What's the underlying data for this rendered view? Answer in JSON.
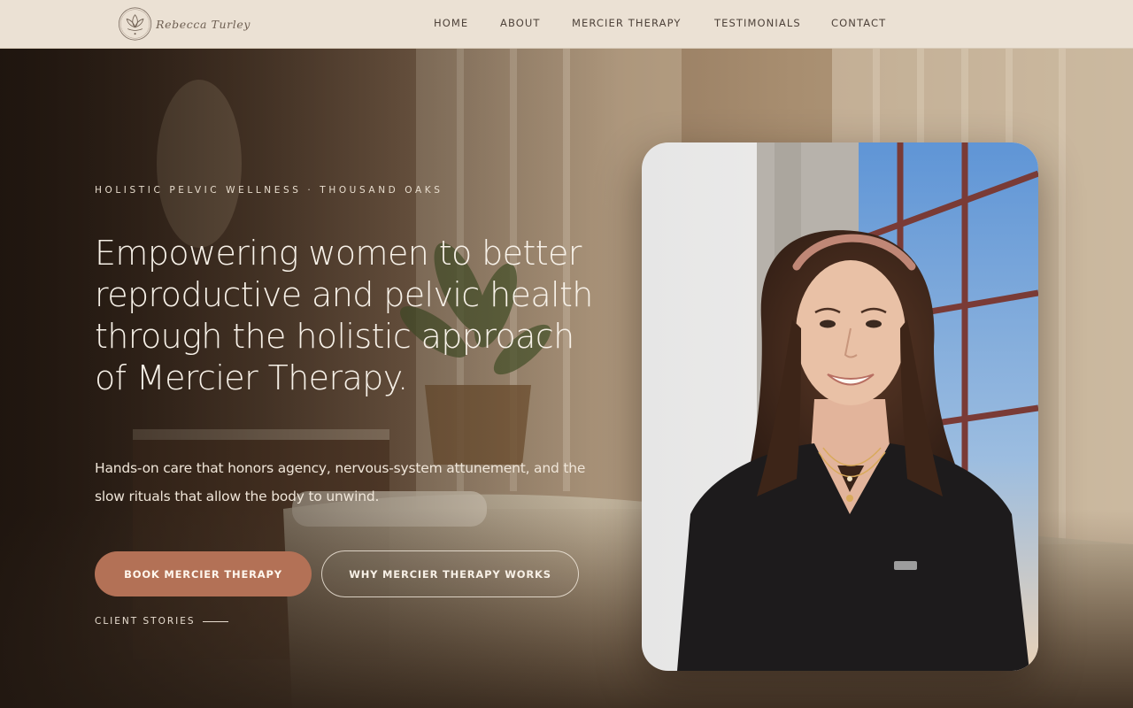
{
  "brand": {
    "name": "Rebecca Turley",
    "logo_icon": "lotus-logo-icon"
  },
  "nav": {
    "items": [
      {
        "label": "HOME"
      },
      {
        "label": "ABOUT"
      },
      {
        "label": "MERCIER THERAPY"
      },
      {
        "label": "TESTIMONIALS"
      },
      {
        "label": "CONTACT"
      }
    ]
  },
  "hero": {
    "eyebrow": "HOLISTIC PELVIC WELLNESS · THOUSAND OAKS",
    "headline": "Empowering women to better reproductive and pelvic health through the holistic approach of Mercier Therapy.",
    "lede": "Hands-on care that honors agency, nervous-system attunement, and the slow rituals that allow the body to unwind.",
    "primary_cta": "BOOK MERCIER THERAPY",
    "secondary_cta": "WHY MERCIER THERAPY WORKS",
    "stories_link": "CLIENT STORIES"
  },
  "colors": {
    "header_bg": "#ebe1d4",
    "accent": "#b37156",
    "nav_text": "#4e423a",
    "hero_text": "#f7f1e8"
  }
}
